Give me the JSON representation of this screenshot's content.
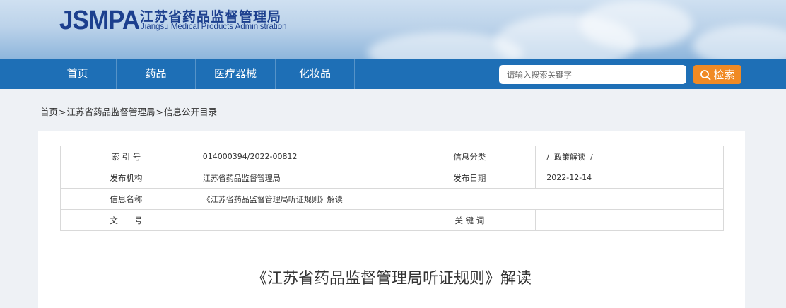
{
  "header": {
    "logo_abbr": "JSMPA",
    "org_name_cn": "江苏省药品监督管理局",
    "org_name_en": "Jiangsu Medical Products Administration"
  },
  "nav": {
    "items": [
      "首页",
      "药品",
      "医疗器械",
      "化妆品"
    ],
    "search_placeholder": "请输入搜索关键字",
    "search_button": "检索"
  },
  "breadcrumb": {
    "items": [
      "首页",
      "江苏省药品监督管理局",
      "信息公开目录"
    ],
    "separator": ">"
  },
  "meta": {
    "index_label": "索 引 号",
    "index_value": "014000394/2022-00812",
    "category_label": "信息分类",
    "category_value": "/  政策解读  /",
    "publisher_label": "发布机构",
    "publisher_value": "江苏省药品监督管理局",
    "date_label": "发布日期",
    "date_value": "2022-12-14",
    "name_label": "信息名称",
    "name_value": "《江苏省药品监督管理局听证规则》解读",
    "docno_label": "文　　号",
    "docno_value": "",
    "keywords_label": "关 键 词",
    "keywords_value": ""
  },
  "article": {
    "title": "《江苏省药品监督管理局听证规则》解读"
  },
  "colors": {
    "nav_bg": "#1e6fb6",
    "logo_blue": "#1c3f8e",
    "search_button": "#f08a24"
  }
}
